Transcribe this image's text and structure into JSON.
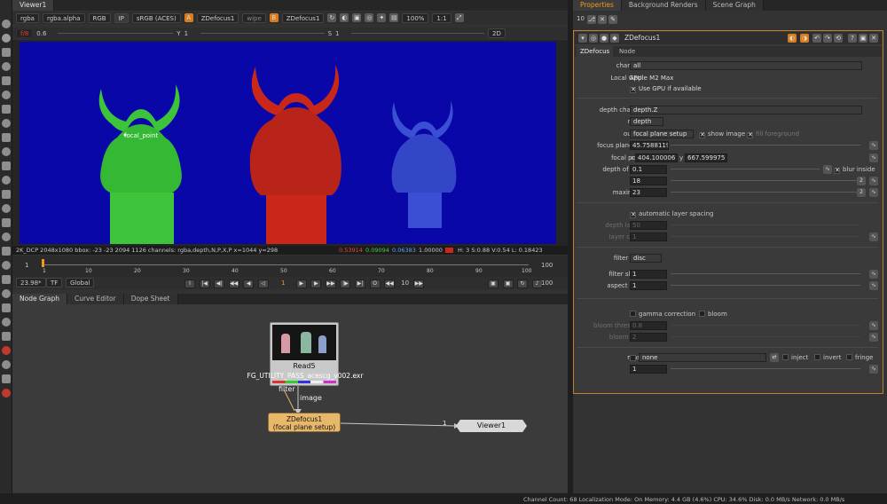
{
  "viewer": {
    "tab": "Viewer1",
    "channels": "rgba",
    "alpha_channel": "rgba.alpha",
    "display_channels": "RGB",
    "ip_label": "IP",
    "colorspace": "sRGB (ACES)",
    "input_a_label": "A",
    "input_a": "ZDefocus1",
    "wipe": "wipe",
    "input_b_label": "B",
    "input_b": "ZDefocus1",
    "zoom": "100%",
    "ratio": "1:1",
    "gain_label": "f/8",
    "gain_value": "0.6",
    "gamma_label": "Y",
    "gamma_value": "1",
    "saturation_label": "S",
    "saturation_value": "1",
    "view_mode": "2D",
    "overlay_label": "focal_point",
    "info_format": "2K_DCP 2048x1080",
    "info_bbox": "bbox: -23 -23 2094 1126 channels: rgba,depth,N,P,X,P",
    "info_xy": "x=1044 y=298",
    "info_r": "0.53914",
    "info_g": "0.09094",
    "info_b": "0.06383",
    "info_a": "1.00000",
    "info_hsvl": "H:  3 S:0.88 V:0.54  L: 0.18423"
  },
  "timeline": {
    "start": "1",
    "end": "100",
    "ticks": [
      "1",
      "10",
      "20",
      "30",
      "40",
      "50",
      "60",
      "70",
      "80",
      "90",
      "100"
    ],
    "fps": "23.98*",
    "tf_label": "TF",
    "global_label": "Global",
    "current_frame": "1",
    "increment": "10",
    "end_frame": "100"
  },
  "node_graph": {
    "tabs": [
      "Node Graph",
      "Curve Editor",
      "Dope Sheet"
    ],
    "read_node": {
      "name": "Read5",
      "file": "FG_UTILITY_PASS_acescg_v002.exr"
    },
    "pipe_filter": "filter",
    "pipe_image": "image",
    "zdefocus_node": {
      "name": "ZDefocus1",
      "subtitle": "(focal plane setup)"
    },
    "viewer_node": {
      "name": "Viewer1",
      "input": "1"
    }
  },
  "properties": {
    "tabs": [
      "Properties",
      "Background Renders",
      "Scene Graph"
    ],
    "max_panels": "10",
    "node_name": "ZDefocus1",
    "subtabs": [
      "ZDefocus",
      "Node"
    ],
    "channels_label": "channels",
    "channels_value": "all",
    "gpu_label": "Local GPU:",
    "gpu_value": "Apple M2 Max",
    "use_gpu_label": "Use GPU if available",
    "depth_channel_label": "depth channel",
    "depth_channel_value": "depth.Z",
    "math_label": "math",
    "math_value": "depth",
    "output_label": "output",
    "output_value": "focal plane setup",
    "show_image_label": "show image",
    "fill_foreground_label": "fill foreground",
    "focus_plane_label": "focus plane (C)",
    "focus_plane_value": "45.7588119!",
    "focal_point_label": "focal point",
    "focal_point_x_label": "x",
    "focal_point_x": "404.100006",
    "focal_point_y_label": "y",
    "focal_point_y": "667.599975",
    "depth_of_field_label": "depth of field",
    "depth_of_field_value": "0.1",
    "blur_inside_label": "blur inside",
    "size_label": "size",
    "size_value": "18",
    "maximum_label": "maximum",
    "maximum_value": "23",
    "auto_layer_label": "automatic layer spacing",
    "depth_layers_label": "depth layers",
    "depth_layers_value": "50",
    "layer_curve_label": "layer curve",
    "layer_curve_value": "1",
    "filter_type_label": "filter type",
    "filter_type_value": "disc",
    "filter_shape_label": "filter shape",
    "filter_shape_value": "1",
    "aspect_ratio_label": "aspect ratio",
    "aspect_ratio_value": "1",
    "gamma_correction_label": "gamma correction",
    "bloom_label": "bloom",
    "bloom_threshold_label": "bloom threshold",
    "bloom_threshold_value": "0.8",
    "bloom_gain_label": "bloom gain",
    "bloom_gain_value": "2",
    "mask_label": "mask",
    "mask_value": "none",
    "inject_label": "inject",
    "invert_label": "invert",
    "fringe_label": "fringe",
    "mix_label": "mix",
    "mix_value": "1",
    "slider_ticks_0_1": [
      "0",
      "0.1",
      "0.2",
      "0.3",
      "0.4",
      "0.5",
      "0.6",
      "0.7",
      "0.8",
      "0.9",
      "1"
    ],
    "slider_ticks_size": [
      "0",
      "2",
      "4",
      "6",
      "8",
      "10",
      "12",
      "14",
      "16",
      "18",
      "20",
      "25"
    ],
    "slider_ticks_layers": [
      "5",
      "10",
      "15",
      "20",
      "25",
      "30",
      "35",
      "40",
      "45",
      "50",
      "55",
      "60"
    ],
    "slider_ticks_curve": [
      "0",
      "0.5",
      "1",
      "1.5",
      "2",
      "2.5",
      "3",
      "3.5",
      "4",
      "4.5",
      "5"
    ]
  },
  "status_bar": "Channel Count: 68  Localization Mode: On  Memory: 4.4 GB (4.6%)  CPU: 34.6%  Disk: 0.0 MB/s  Network: 0.0 MB/s",
  "colors": {
    "viewer_bg": "#0a07a8",
    "green_statue": "#3ec43a",
    "red_statue": "#c9271a",
    "blue_statue": "#3a4fd4",
    "node_orange": "#e8b86a",
    "accent_orange": "#f29a1e"
  }
}
